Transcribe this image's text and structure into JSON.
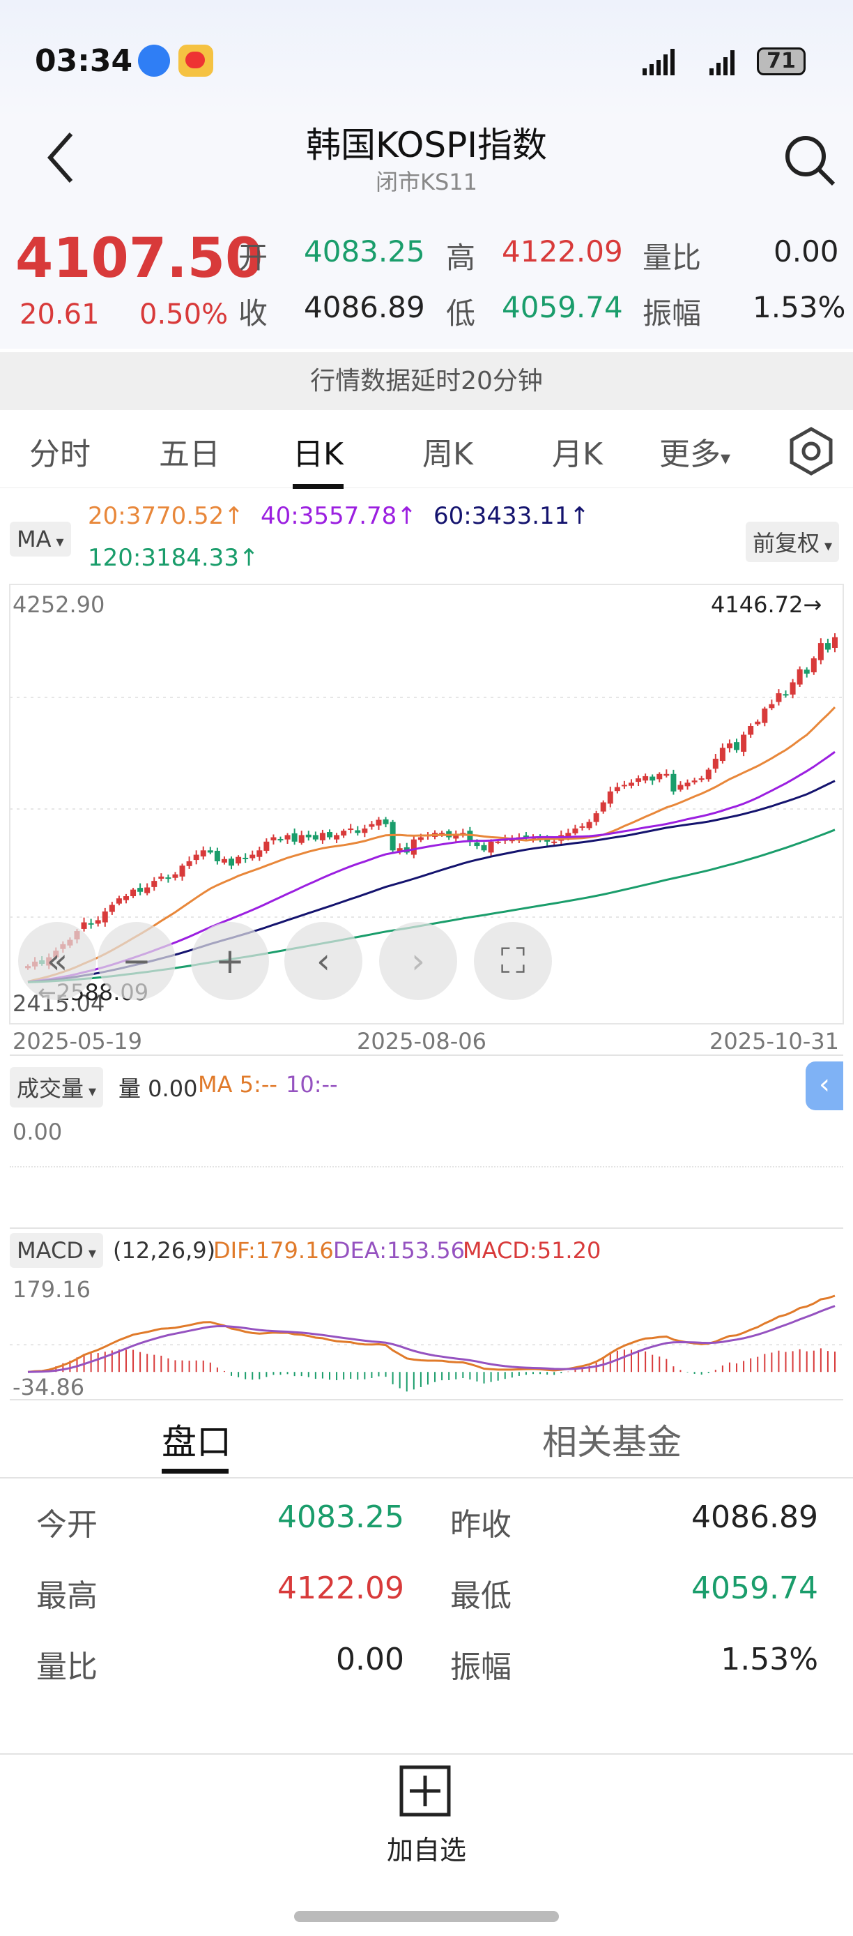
{
  "status": {
    "time": "03:34",
    "battery": "71"
  },
  "header": {
    "title": "韩国KOSPI指数",
    "subtitle": "闭市KS11"
  },
  "quote": {
    "price": "4107.50",
    "change": "20.61",
    "change_pct": "0.50%",
    "open_label": "开",
    "open": "4083.25",
    "high_label": "高",
    "high": "4122.09",
    "ratio_label": "量比",
    "ratio": "0.00",
    "close_label": "收",
    "prev_close": "4086.89",
    "low_label": "低",
    "low": "4059.74",
    "amp_label": "振幅",
    "amp": "1.53%"
  },
  "banner": "行情数据延时20分钟",
  "tabs": [
    "分时",
    "五日",
    "日K",
    "周K",
    "月K",
    "更多"
  ],
  "ma": {
    "selector": "MA",
    "ma20": "20:3770.52↑",
    "ma40": "40:3557.78↑",
    "ma60": "60:3433.11↑",
    "ma120": "120:3184.33↑",
    "adjust": "前复权"
  },
  "colors": {
    "up": "#d83a3a",
    "down": "#1a9d6b",
    "ma20": "#e8873a",
    "ma40": "#9b1fe0",
    "ma60": "#14136e",
    "ma120": "#1a9d6b",
    "dif": "#e07a2a",
    "dea": "#9552c0"
  },
  "chart_data": {
    "type": "candlestick",
    "y_max_label": "4252.90",
    "y_min_label": "2415.04",
    "ylim": [
      2415.04,
      4252.9
    ],
    "max_mark": "4146.72→",
    "min_mark": "←2588.09",
    "x_labels": [
      "2025-05-19",
      "2025-08-06",
      "2025-10-31"
    ],
    "closes": [
      2600,
      2620,
      2610,
      2640,
      2670,
      2700,
      2720,
      2760,
      2800,
      2790,
      2810,
      2850,
      2880,
      2910,
      2920,
      2950,
      2940,
      2960,
      2990,
      3010,
      3000,
      3020,
      3060,
      3080,
      3110,
      3130,
      3120,
      3080,
      3090,
      3060,
      3100,
      3090,
      3110,
      3130,
      3170,
      3190,
      3180,
      3200,
      3170,
      3200,
      3190,
      3180,
      3210,
      3190,
      3200,
      3220,
      3230,
      3210,
      3230,
      3250,
      3270,
      3250,
      3130,
      3140,
      3120,
      3180,
      3190,
      3200,
      3210,
      3210,
      3190,
      3200,
      3210,
      3170,
      3150,
      3130,
      3170,
      3170,
      3180,
      3180,
      3190,
      3190,
      3190,
      3180,
      3170,
      3170,
      3200,
      3210,
      3230,
      3240,
      3260,
      3300,
      3350,
      3400,
      3420,
      3430,
      3440,
      3460,
      3470,
      3450,
      3480,
      3480,
      3400,
      3430,
      3440,
      3450,
      3460,
      3500,
      3550,
      3600,
      3620,
      3590,
      3660,
      3700,
      3720,
      3780,
      3800,
      3850,
      3840,
      3900,
      3960,
      3940,
      4010,
      4080,
      4050,
      4107
    ]
  },
  "volume": {
    "selector": "成交量",
    "value": "量 0.00",
    "ma5": "MA 5:--",
    "ma10": "10:--",
    "axis": "0.00"
  },
  "macd": {
    "selector": "MACD",
    "params": "(12,26,9)",
    "dif": "DIF:179.16",
    "dea": "DEA:153.56",
    "macd": "MACD:51.20",
    "max": "179.16",
    "min": "-34.86"
  },
  "panel_tabs": [
    "盘口",
    "相关基金"
  ],
  "details": [
    {
      "l1": "今开",
      "v1": "4083.25",
      "c1": "green",
      "l2": "昨收",
      "v2": "4086.89",
      "c2": "dark"
    },
    {
      "l1": "最高",
      "v1": "4122.09",
      "c1": "red",
      "l2": "最低",
      "v2": "4059.74",
      "c2": "green"
    },
    {
      "l1": "量比",
      "v1": "0.00",
      "c1": "dark",
      "l2": "振幅",
      "v2": "1.53%",
      "c2": "dark"
    }
  ],
  "bottom": {
    "add_label": "加自选"
  }
}
